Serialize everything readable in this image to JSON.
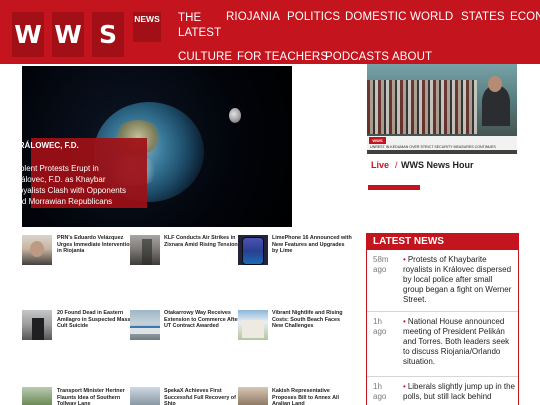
{
  "header": {
    "logo_letters": [
      "W",
      "W",
      "S"
    ],
    "news_tag": "NEWS",
    "nav": {
      "latest": "THE LATEST",
      "riojania": "RIOJANIA",
      "politics": "POLITICS",
      "domestic": "DOMESTIC",
      "world": "WORLD",
      "states": "STATES",
      "economy": "ECONOMY",
      "culture": "CULTURE",
      "for_teachers": "FOR TEACHERS",
      "podcasts": "PODCASTS",
      "about": "ABOUT"
    }
  },
  "hero": {
    "kicker": "KRÁLOWEC, F.D.",
    "title": "Violent Protests Erupt in Královec, F.D. as Khaybar Royalists Clash with Opponents and Morrawian Republicans"
  },
  "stories": [
    {
      "headline": "PRN's Eduardo Velázquez Urges Immediate Intervention in Riojania"
    },
    {
      "headline": "KLF Conducts Air Strikes in Zixnara Amid Rising Tensions"
    },
    {
      "headline": "LimePhone 16 Announced with New Features and Upgrades by Lime"
    },
    {
      "headline": "20 Found Dead in Eastern Amilagro in Suspected Mass Cult Suicide"
    },
    {
      "headline": "Otakarrowy Way Receives Extension to Commerce After UT Contract Awarded"
    },
    {
      "headline": "Vibrant Nightlife and Rising Costs: South Beach Faces New Challenges"
    },
    {
      "headline": "Transport Minister Hertner Flaunts Idea of Southern Tollway Lane"
    },
    {
      "headline": "SpekaX Achieves First Successful Full Recovery of Ship"
    },
    {
      "headline": "Kakish Representative Proposes Bill to Annex All Aralian Land"
    }
  ],
  "video": {
    "brand": "WWS",
    "ticker": "UNREST IN KEDUMAN OVER STRICT SECURITY MEASURES CONTINUES"
  },
  "live": {
    "label": "Live",
    "separator": "/",
    "title": "WWS News Hour"
  },
  "latest": {
    "heading": "LATEST NEWS",
    "items": [
      {
        "time": "58m ago",
        "text": "Protests of Khaybarite royalists in Královec dispersed by local police after small group began a fight on Werner Street."
      },
      {
        "time": "1h ago",
        "text": "National House announced meeting of President Pelikán and Torres. Both leaders seek to discuss Riojania/Orlando situation."
      },
      {
        "time": "1h ago",
        "text": "Liberals slightly jump up in the polls, but still lack behind"
      }
    ]
  }
}
